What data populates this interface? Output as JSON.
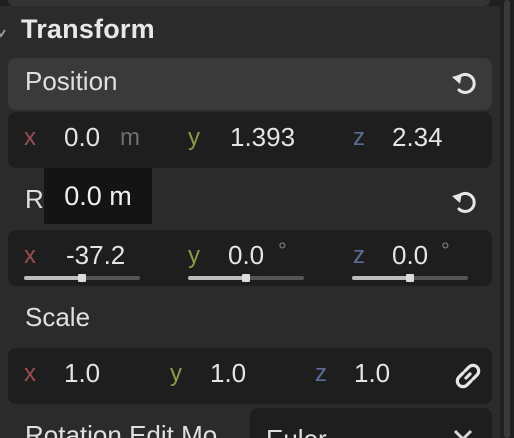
{
  "section": {
    "title": "Transform"
  },
  "position": {
    "label": "Position",
    "x": {
      "axis": "x",
      "value": "0.0",
      "unit": "m"
    },
    "y": {
      "axis": "y",
      "value": "1.393"
    },
    "z": {
      "axis": "z",
      "value": "2.34"
    }
  },
  "rotation": {
    "label_partial": "R",
    "tooltip": "0.0 m",
    "x": {
      "axis": "x",
      "value": "-37.2",
      "slider": 0.5
    },
    "y": {
      "axis": "y",
      "value": "0.0",
      "unit": "°",
      "slider": 0.5
    },
    "z": {
      "axis": "z",
      "value": "0.0",
      "unit": "°",
      "slider": 0.5
    }
  },
  "scale": {
    "label": "Scale",
    "x": {
      "axis": "x",
      "value": "1.0"
    },
    "y": {
      "axis": "y",
      "value": "1.0"
    },
    "z": {
      "axis": "z",
      "value": "1.0"
    }
  },
  "rotation_edit_mode": {
    "label": "Rotation Edit Mo",
    "value": "Euler"
  },
  "icons": {
    "reset": "reset-icon",
    "link": "link-icon",
    "chevron": "chevron-down-icon"
  }
}
